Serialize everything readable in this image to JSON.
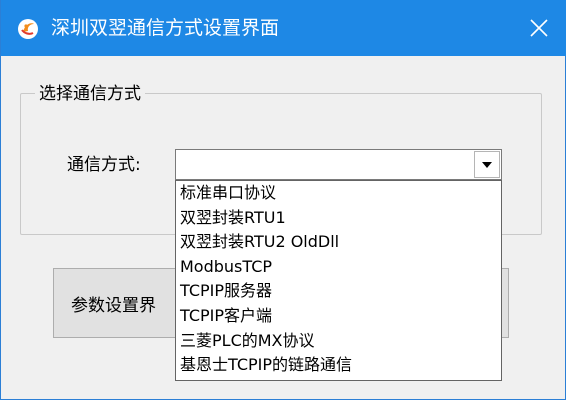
{
  "window": {
    "title": "深圳双翌通信方式设置界面",
    "app_icon": "app-logo-icon",
    "close_icon": "close-icon",
    "colors": {
      "titlebar": "#1e88e5",
      "title_text": "#ffffff",
      "body": "#f0f0f0"
    }
  },
  "group": {
    "title": "选择通信方式",
    "field_label": "通信方式:",
    "combo": {
      "value": "",
      "arrow_icon": "chevron-down-icon",
      "options": [
        "标准串口协议",
        "双翌封装RTU1",
        "双翌封装RTU2 OldDll",
        "ModbusTCP",
        "TCPIP服务器",
        "TCPIP客户端",
        "三菱PLC的MX协议",
        "基恩士TCPIP的链路通信"
      ]
    }
  },
  "buttons": {
    "params_label": "参数设置界",
    "right_label": ""
  }
}
